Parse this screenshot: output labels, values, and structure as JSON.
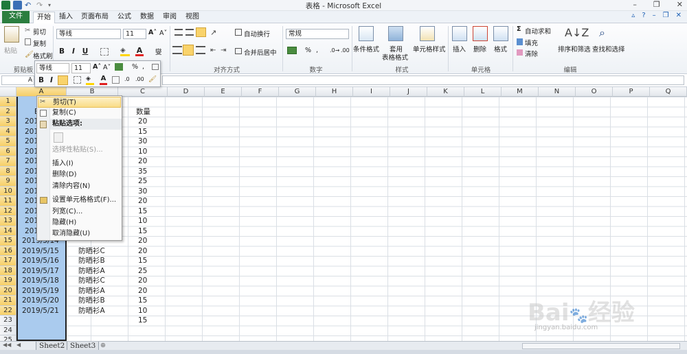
{
  "window": {
    "title": "表格 - Microsoft Excel"
  },
  "tabs": [
    "文件",
    "开始",
    "插入",
    "页面布局",
    "公式",
    "数据",
    "审阅",
    "视图"
  ],
  "ribbon": {
    "paste": "粘贴",
    "cut": "剪切",
    "copy": "复制",
    "format_painter": "格式刷",
    "font_name": "等线",
    "font_size": "11",
    "wrap_text": "自动换行",
    "merge_center": "合并后居中",
    "number_format": "常规",
    "conditional_format": "条件格式",
    "table_format_1": "套用",
    "table_format_2": "表格格式",
    "cell_styles": "单元格样式",
    "insert": "插入",
    "delete": "删除",
    "format": "格式",
    "autosum": "自动求和",
    "fill": "填充",
    "clear": "清除",
    "sort_filter": "排序和筛选",
    "find_select": "查找和选择",
    "groups": {
      "clipboard": "剪贴板",
      "alignment": "对齐方式",
      "number": "数字",
      "styles": "样式",
      "cells": "单元格",
      "editing": "编辑"
    }
  },
  "mini_toolbar": {
    "font_name": "等线",
    "font_size": "11"
  },
  "columns": [
    "A",
    "B",
    "C",
    "D",
    "E",
    "F",
    "G",
    "H",
    "I",
    "J",
    "K",
    "L",
    "M",
    "N",
    "O",
    "P",
    "Q"
  ],
  "rows": [
    "1",
    "2",
    "3",
    "4",
    "5",
    "6",
    "7",
    "8",
    "9",
    "10",
    "11",
    "12",
    "13",
    "14",
    "15",
    "16",
    "17",
    "18",
    "19",
    "20",
    "21",
    "22",
    "23",
    "24",
    "25"
  ],
  "col_a_visible": [
    "B",
    "201",
    "201",
    "201",
    "201",
    "201",
    "201",
    "201",
    "201",
    "201",
    "201",
    "201",
    "201",
    "2019/5/14",
    "2019/5/15",
    "2019/5/16",
    "2019/5/17",
    "2019/5/18",
    "2019/5/19",
    "2019/5/20",
    "2019/5/21"
  ],
  "col_b_visible": [
    "防晒衫C",
    "防晒衫B",
    "防晒衫A",
    "防晒衫C",
    "防晒衫A",
    "防晒衫B",
    "防晒衫A"
  ],
  "col_c": [
    "数量",
    "20",
    "15",
    "30",
    "10",
    "20",
    "35",
    "25",
    "30",
    "20",
    "15",
    "10",
    "15",
    "20",
    "20",
    "15",
    "25",
    "20",
    "20",
    "15",
    "10",
    "15"
  ],
  "context_menu": {
    "cut": "剪切(T)",
    "copy": "复制(C)",
    "paste_options": "粘贴选项:",
    "paste_special": "选择性粘贴(S)...",
    "insert": "插入(I)",
    "delete": "删除(D)",
    "clear": "清除内容(N)",
    "format_cells": "设置单元格格式(F)...",
    "col_width": "列宽(C)...",
    "hide": "隐藏(H)",
    "unhide": "取消隐藏(U)"
  },
  "sheets": [
    "Sheet2",
    "Sheet3"
  ],
  "watermark": {
    "brand": "Bai",
    "brand2": "经验",
    "url": "jingyan.baidu.com"
  },
  "colors": {
    "file_tab": "#2b7e3f",
    "selection": "#aacbee",
    "header_selected": "#f6cf67"
  }
}
